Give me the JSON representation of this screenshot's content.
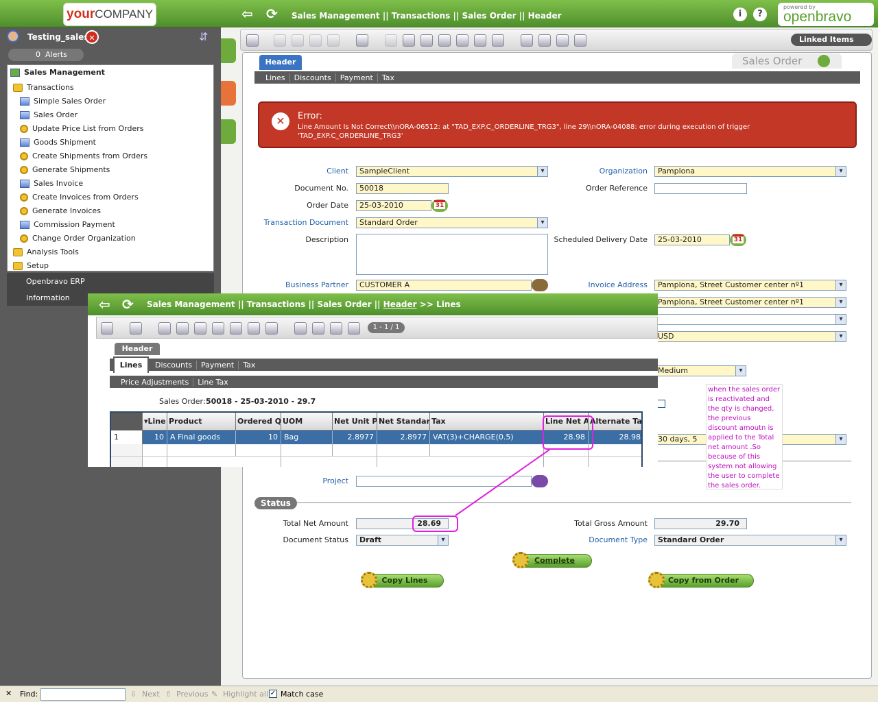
{
  "topbar": {
    "logo_your": "your",
    "logo_company": "COMPANY",
    "breadcrumb": "Sales Management  ||  Transactions  ||  Sales Order  ||  Header",
    "powered_by": "powered by",
    "brand": "openbravo",
    "info_icon": "i",
    "help_icon": "?"
  },
  "user": {
    "name": "Testing_sales",
    "close": "✕"
  },
  "alerts": {
    "count": "0",
    "label": "Alerts"
  },
  "menu": {
    "root": "Sales Management",
    "transactions": "Transactions",
    "items": [
      {
        "label": "Simple Sales Order",
        "icon": "window-icon"
      },
      {
        "label": "Sales Order",
        "icon": "window-icon"
      },
      {
        "label": "Update Price List from Orders",
        "icon": "process-icon"
      },
      {
        "label": "Goods Shipment",
        "icon": "window-icon"
      },
      {
        "label": "Create Shipments from Orders",
        "icon": "process-icon"
      },
      {
        "label": "Generate Shipments",
        "icon": "process-icon"
      },
      {
        "label": "Sales Invoice",
        "icon": "window-icon"
      },
      {
        "label": "Create Invoices from Orders",
        "icon": "process-icon"
      },
      {
        "label": "Generate Invoices",
        "icon": "process-icon"
      },
      {
        "label": "Commission Payment",
        "icon": "window-icon"
      },
      {
        "label": "Change Order Organization",
        "icon": "process-icon"
      }
    ],
    "analysis_tools": "Analysis Tools",
    "setup": "Setup",
    "openbravo_erp": "Openbravo ERP",
    "information": "Information"
  },
  "main": {
    "linked_items": "Linked Items",
    "tab_header": "Header",
    "window_title": "Sales Order",
    "subtabs": [
      "Lines",
      "Discounts",
      "Payment",
      "Tax"
    ]
  },
  "error": {
    "title": "Error:",
    "message": "Line Amount Is Not Correct\\\\nORA-06512: at \"TAD_EXP.C_ORDERLINE_TRG3\", line 29\\\\nORA-04088: error during execution of trigger 'TAD_EXP.C_ORDERLINE_TRG3'"
  },
  "form": {
    "client_label": "Client",
    "client": "SampleClient",
    "organization_label": "Organization",
    "organization": "Pamplona",
    "docno_label": "Document No.",
    "docno": "50018",
    "orderref_label": "Order Reference",
    "orderref": "",
    "orderdate_label": "Order Date",
    "orderdate": "25-03-2010",
    "txdoc_label": "Transaction Document",
    "txdoc": "Standard Order",
    "description_label": "Description",
    "description": "",
    "sched_label": "Scheduled Delivery Date",
    "sched": "25-03-2010",
    "bp_label": "Business Partner",
    "bp": "CUSTOMER A",
    "invaddr_label": "Invoice Address",
    "invaddr": "Pamplona, Street Customer center nº1",
    "deladdr": "Pamplona, Street Customer center nº1",
    "currency": "USD",
    "priority": "Medium",
    "payterm": "30 days, 5",
    "project_label": "Project",
    "project": "",
    "status_section": "Status",
    "totalnet_label": "Total Net Amount",
    "totalnet": "28.69",
    "totalgross_label": "Total Gross Amount",
    "totalgross": "29.70",
    "docstatus_label": "Document Status",
    "docstatus": "Draft",
    "doctype_label": "Document Type",
    "doctype": "Standard Order",
    "complete_btn": "Complete",
    "copylines_btn": "Copy Lines",
    "copyorder_btn": "Copy from Order",
    "calendar_day": "31"
  },
  "popup": {
    "crumb_a": "Sales Management  ||  Transactions  ||  Sales Order  ||",
    "crumb_header": "Header",
    "crumb_b": ">> Lines",
    "page": "1 - 1 / 1",
    "tab_header": "Header",
    "tab_lines": "Lines",
    "subtabs": [
      "Discounts",
      "Payment",
      "Tax"
    ],
    "subtabs2": [
      "Price Adjustments",
      "Line Tax"
    ],
    "so_label": "Sales Order:",
    "so_value": "50018 - 25-03-2010 - 29.7",
    "columns": [
      "",
      "▾Line",
      "Product",
      "Ordered Qu",
      "UOM",
      "Net Unit Pri",
      "Net Standard",
      "Tax",
      "Line Net Am",
      "Alternate Tax"
    ],
    "row": [
      "1",
      "10",
      "A Final goods",
      "10",
      "Bag",
      "2.8977",
      "2.8977",
      "VAT(3)+CHARGE(0.5)",
      "28.98",
      "28.98"
    ]
  },
  "annotation": "when the sales order is reactivated and the qty is changed, the previous discount amoutn is applied to the Total net amount .So because of this system not allowing the user to complete the sales order.",
  "findbar": {
    "close": "✕",
    "find": "Find:",
    "next": "Next",
    "previous": "Previous",
    "highlight": "Highlight all",
    "match_case": "Match case",
    "check": "✓"
  },
  "colors": {
    "brand_green": "#5aa12d",
    "error_red": "#c33727",
    "annotation_magenta": "#e020e0",
    "grid_selected": "#3a6ea5"
  }
}
